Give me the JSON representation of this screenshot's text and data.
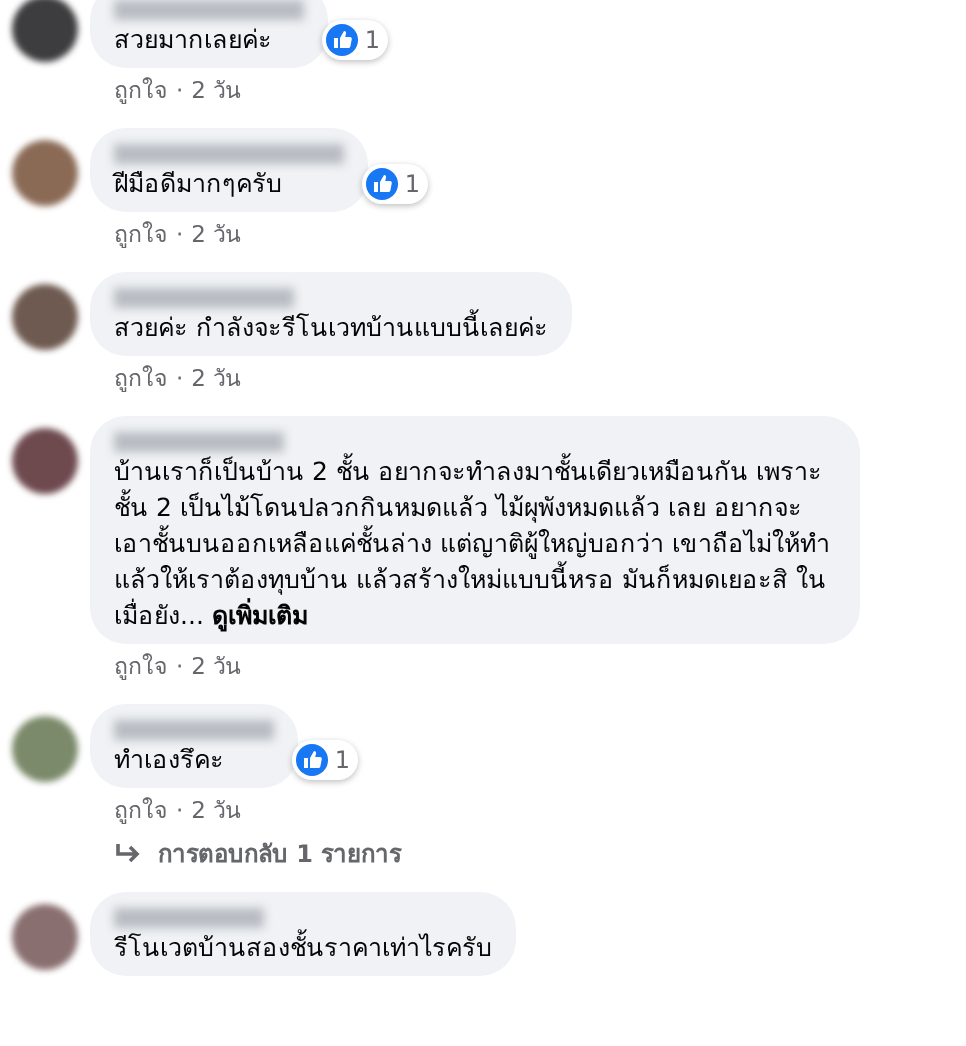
{
  "comments": [
    {
      "text": "สวยมากเลยค่ะ",
      "reactions": "1",
      "like": "ถูกใจ",
      "sep": "·",
      "time": "2 วัน"
    },
    {
      "text": "ฝีมือดีมากๆครับ",
      "reactions": "1",
      "like": "ถูกใจ",
      "sep": "·",
      "time": "2 วัน"
    },
    {
      "text": "สวยค่ะ กำลังจะรีโนเวทบ้านแบบนี้เลยค่ะ",
      "like": "ถูกใจ",
      "sep": "·",
      "time": "2 วัน"
    },
    {
      "text": "บ้านเราก็เป็นบ้าน 2 ชั้น อยากจะทำลงมาชั้นเดียวเหมือนกัน เพราะชั้น 2 เป็นไม้โดนปลวกกินหมดแล้ว ไม้ผุพังหมดแล้ว เลย อยากจะเอาชั้นบนออกเหลือแค่ชั้นล่าง แต่ญาติผู้ใหญ่บอกว่า เขาถือไม่ให้ทำ แล้วให้เราต้องทุบบ้าน แล้วสร้างใหม่แบบนี้หรอ มันก็หมดเยอะสิ ในเมื่อยัง...",
      "see_more": "ดูเพิ่มเติม",
      "like": "ถูกใจ",
      "sep": "·",
      "time": "2 วัน"
    },
    {
      "text": "ทำเองรึคะ",
      "reactions": "1",
      "like": "ถูกใจ",
      "sep": "·",
      "time": "2 วัน",
      "replies": "การตอบกลับ 1 รายการ"
    },
    {
      "text": "รีโนเวตบ้านสองชั้นราคาเท่าไรครับ"
    }
  ]
}
